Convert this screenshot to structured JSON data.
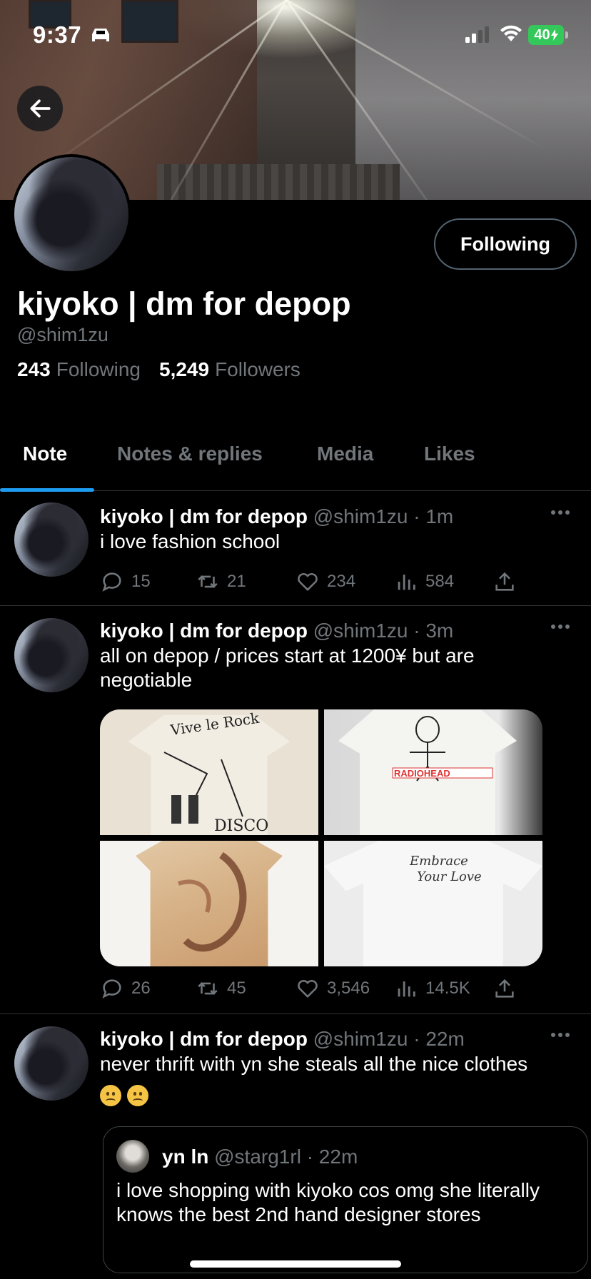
{
  "status_bar": {
    "time": "9:37",
    "battery": "40"
  },
  "profile": {
    "display_name": "kiyoko | dm for depop",
    "handle": "@shim1zu",
    "following_count": "243",
    "following_label": "Following",
    "followers_count": "5,249",
    "followers_label": "Followers",
    "follow_button": "Following"
  },
  "tabs": [
    {
      "label": "Note",
      "active": true
    },
    {
      "label": "Notes & replies",
      "active": false
    },
    {
      "label": "Media",
      "active": false
    },
    {
      "label": "Likes",
      "active": false
    }
  ],
  "posts": [
    {
      "name": "kiyoko | dm for depop",
      "meta": "@shim1zu · 1m",
      "text": "i love fashion school",
      "replies": "15",
      "reposts": "21",
      "likes": "234",
      "views": "584"
    },
    {
      "name": "kiyoko | dm for depop",
      "meta": "@shim1zu · 3m",
      "text": "all on depop / prices start at 1200¥ but are negotiable",
      "images": [
        "Vive le Rock punk tee",
        "Radiohead tee",
        "painted figure tee",
        "white script tee"
      ],
      "replies": "26",
      "reposts": "45",
      "likes": "3,546",
      "views": "14.5K"
    },
    {
      "name": "kiyoko | dm for depop",
      "meta": "@shim1zu · 22m",
      "text": "never thrift with yn she steals all the nice clothes",
      "quote": {
        "name": "yn ln",
        "meta": "@starg1rl · 22m",
        "text": "i love shopping with kiyoko cos omg she literally knows the best 2nd hand designer stores"
      }
    }
  ]
}
